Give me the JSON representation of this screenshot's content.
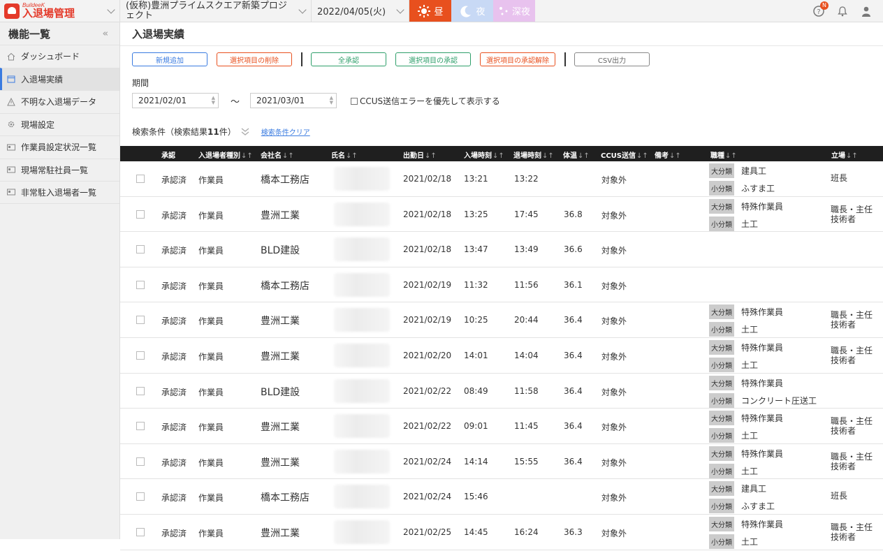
{
  "header": {
    "brand_small": "BuildeeK",
    "brand_main": "入退場管理",
    "project": "(仮称)豊洲プライムスクエア新築プロジェクト",
    "date": "2022/04/05(火)",
    "shift_day": "昼",
    "shift_night": "夜",
    "shift_late": "深夜",
    "notification_badge": "N"
  },
  "sidebar": {
    "title": "機能一覧",
    "collapse": "«",
    "items": [
      {
        "label": "ダッシュボード"
      },
      {
        "label": "入退場実績"
      },
      {
        "label": "不明な入退場データ"
      },
      {
        "label": "現場設定"
      },
      {
        "label": "作業員設定状況一覧"
      },
      {
        "label": "現場常駐社員一覧"
      },
      {
        "label": "非常駐入退場者一覧"
      }
    ]
  },
  "main": {
    "title": "入退場実績",
    "toolbar": {
      "new": "新規追加",
      "delete": "選択項目の削除",
      "approve_all": "全承認",
      "approve_selected": "選択項目の承認",
      "unapprove_selected": "選択項目の承認解除",
      "csv": "CSV出力"
    },
    "period_label": "期間",
    "date_from": "2021/02/01",
    "tilde": "～",
    "date_to": "2021/03/01",
    "ccus_label": "CCUS送信エラーを優先して表示する",
    "search_prefix": "検索条件（検索結果",
    "search_count": "11",
    "search_suffix": "件）",
    "clear_label": "検索条件クリア"
  },
  "table": {
    "headers": [
      "承認",
      "入退場者種別",
      "会社名",
      "氏名",
      "出勤日",
      "入場時刻",
      "退場時刻",
      "体温",
      "CCUS送信",
      "備考",
      "職種",
      "立場"
    ],
    "sort_glyph": "↓↑",
    "tag_major": "大分類",
    "tag_minor": "小分類",
    "rows": [
      {
        "status": "承認済",
        "type": "作業員",
        "company": "橋本工務店",
        "date": "2021/02/18",
        "in": "13:21",
        "out": "13:22",
        "temp": "",
        "ccus": "対象外",
        "major": "建具工",
        "minor": "ふすま工",
        "role": "班長"
      },
      {
        "status": "承認済",
        "type": "作業員",
        "company": "豊洲工業",
        "date": "2021/02/18",
        "in": "13:25",
        "out": "17:45",
        "temp": "36.8",
        "ccus": "対象外",
        "major": "特殊作業員",
        "minor": "土工",
        "role": "職長・主任技術者"
      },
      {
        "status": "承認済",
        "type": "作業員",
        "company": "BLD建設",
        "date": "2021/02/18",
        "in": "13:47",
        "out": "13:49",
        "temp": "36.6",
        "ccus": "対象外",
        "major": "",
        "minor": "",
        "role": ""
      },
      {
        "status": "承認済",
        "type": "作業員",
        "company": "橋本工務店",
        "date": "2021/02/19",
        "in": "11:32",
        "out": "11:56",
        "temp": "36.1",
        "ccus": "対象外",
        "major": "",
        "minor": "",
        "role": ""
      },
      {
        "status": "承認済",
        "type": "作業員",
        "company": "豊洲工業",
        "date": "2021/02/19",
        "in": "10:25",
        "out": "20:44",
        "temp": "36.4",
        "ccus": "対象外",
        "major": "特殊作業員",
        "minor": "土工",
        "role": "職長・主任技術者"
      },
      {
        "status": "承認済",
        "type": "作業員",
        "company": "豊洲工業",
        "date": "2021/02/20",
        "in": "14:01",
        "out": "14:04",
        "temp": "36.4",
        "ccus": "対象外",
        "major": "特殊作業員",
        "minor": "土工",
        "role": "職長・主任技術者"
      },
      {
        "status": "承認済",
        "type": "作業員",
        "company": "BLD建設",
        "date": "2021/02/22",
        "in": "08:49",
        "out": "11:58",
        "temp": "36.4",
        "ccus": "対象外",
        "major": "特殊作業員",
        "minor": "コンクリート圧送工",
        "role": ""
      },
      {
        "status": "承認済",
        "type": "作業員",
        "company": "豊洲工業",
        "date": "2021/02/22",
        "in": "09:01",
        "out": "11:45",
        "temp": "36.4",
        "ccus": "対象外",
        "major": "特殊作業員",
        "minor": "土工",
        "role": "職長・主任技術者"
      },
      {
        "status": "承認済",
        "type": "作業員",
        "company": "豊洲工業",
        "date": "2021/02/24",
        "in": "14:14",
        "out": "15:55",
        "temp": "36.4",
        "ccus": "対象外",
        "major": "特殊作業員",
        "minor": "土工",
        "role": "職長・主任技術者"
      },
      {
        "status": "承認済",
        "type": "作業員",
        "company": "橋本工務店",
        "date": "2021/02/24",
        "in": "15:46",
        "out": "",
        "temp": "",
        "ccus": "対象外",
        "major": "建具工",
        "minor": "ふすま工",
        "role": "班長"
      },
      {
        "status": "承認済",
        "type": "作業員",
        "company": "豊洲工業",
        "date": "2021/02/25",
        "in": "14:45",
        "out": "16:24",
        "temp": "36.3",
        "ccus": "対象外",
        "major": "特殊作業員",
        "minor": "土工",
        "role": "職長・主任技術者"
      }
    ]
  },
  "colors": {
    "brand": "#e43a2a",
    "accent": "#3a7be0",
    "day": "#e8501e",
    "night": "#c8d9f5",
    "late": "#e8c2ee"
  }
}
